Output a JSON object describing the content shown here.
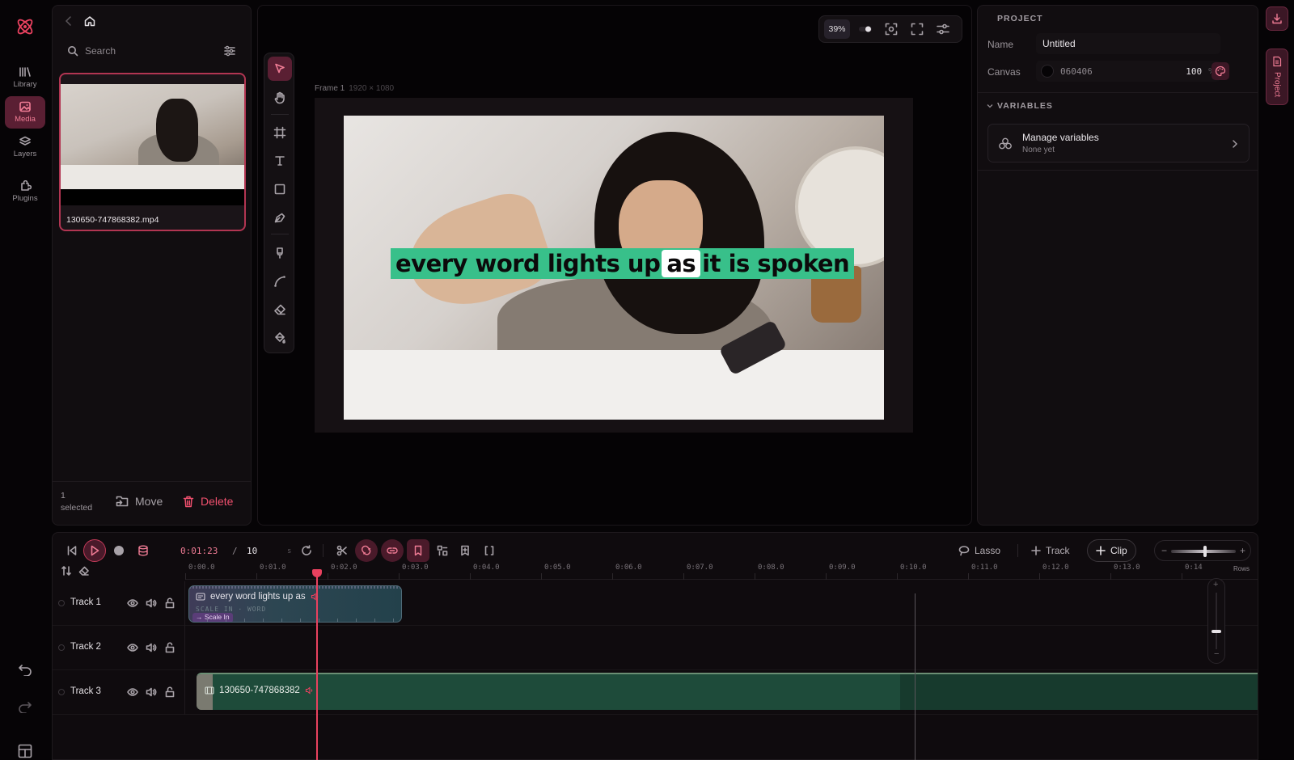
{
  "rail": {
    "items": [
      {
        "label": "Library",
        "icon": "library-icon"
      },
      {
        "label": "Media",
        "icon": "media-icon",
        "active": true
      },
      {
        "label": "Layers",
        "icon": "layers-icon"
      },
      {
        "label": "Plugins",
        "icon": "plugins-icon"
      }
    ]
  },
  "media": {
    "search_placeholder": "Search",
    "file_name": "130650-747868382.mp4",
    "selected_count": "1",
    "selected_label": "selected",
    "move_label": "Move",
    "delete_label": "Delete"
  },
  "canvas": {
    "zoom": "39%",
    "frame_name": "Frame 1",
    "frame_size": "1920 × 1080",
    "caption_before": "every word lights up",
    "caption_highlight": "as",
    "caption_after": "it is spoken"
  },
  "properties": {
    "section_project": "PROJECT",
    "name_label": "Name",
    "name_value": "Untitled",
    "canvas_label": "Canvas",
    "canvas_color": "060406",
    "canvas_opacity": "100",
    "canvas_opacity_unit": "%",
    "section_variables": "VARIABLES",
    "manage_title": "Manage variables",
    "manage_sub": "None yet",
    "side_tab": "Project"
  },
  "timeline": {
    "current_time": "0:01:23",
    "separator": "/",
    "duration": "10",
    "duration_unit": "s",
    "lasso_label": "Lasso",
    "track_label": "Track",
    "clip_label": "Clip",
    "rows_label": "Rows",
    "ruler": [
      "0:00.0",
      "0:01.0",
      "0:02.0",
      "0:03.0",
      "0:04.0",
      "0:05.0",
      "0:06.0",
      "0:07.0",
      "0:08.0",
      "0:09.0",
      "0:10.0",
      "0:11.0",
      "0:12.0",
      "0:13.0",
      "0:14"
    ],
    "tracks": [
      {
        "name": "Track 1"
      },
      {
        "name": "Track 2"
      },
      {
        "name": "Track 3"
      }
    ],
    "text_clip": {
      "title": "every word lights up as",
      "sub": "SCALE IN · WORD",
      "tag": "Scale In"
    },
    "video_clip": {
      "title": "130650-747868382"
    }
  },
  "colors": {
    "accent": "#e9415f",
    "active_bg": "#5a1f33",
    "caption_bg": "#38c08a"
  }
}
